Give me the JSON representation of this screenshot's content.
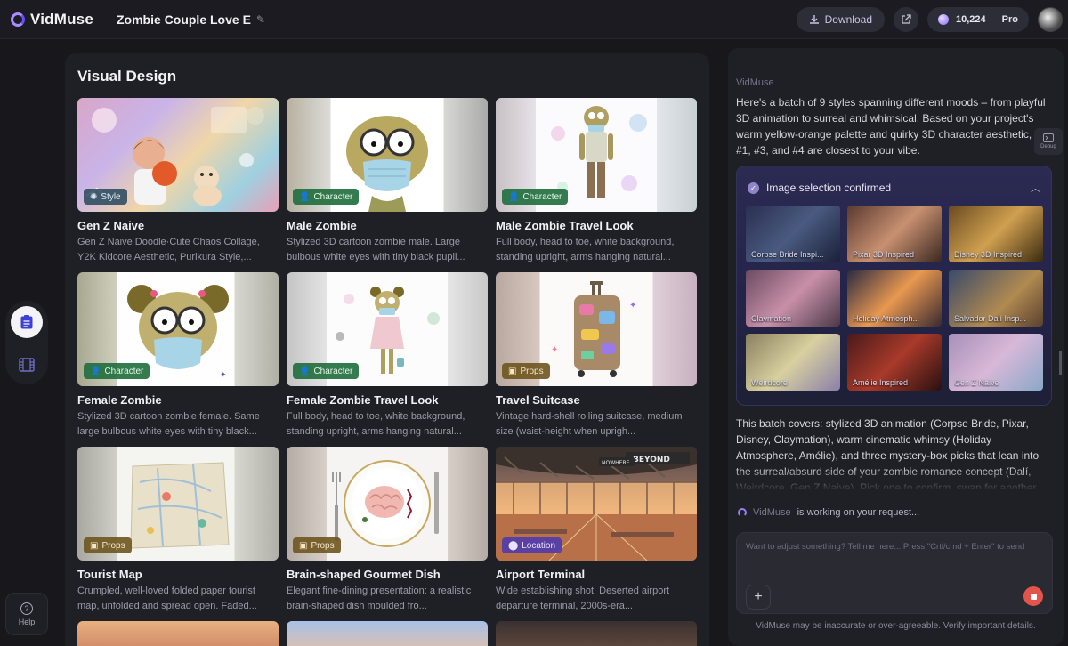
{
  "app": {
    "name": "VidMuse",
    "project_title": "Zombie Couple Love E"
  },
  "topbar": {
    "download_label": "Download",
    "credits": "10,224",
    "plan": "Pro"
  },
  "sidebar": {
    "help_label": "Help"
  },
  "main": {
    "title": "Visual Design",
    "cards": [
      {
        "title": "Gen Z Naive",
        "tag": "Style",
        "desc": "Gen Z Naive Doodle·Cute Chaos Collage, Y2K Kidcore Aesthetic, Purikura Style,..."
      },
      {
        "title": "Male Zombie",
        "tag": "Character",
        "desc": "Stylized 3D cartoon zombie male. Large bulbous white eyes with tiny black pupil..."
      },
      {
        "title": "Male Zombie Travel Look",
        "tag": "Character",
        "desc": "Full body, head to toe, white background, standing upright, arms hanging natural..."
      },
      {
        "title": "Female Zombie",
        "tag": "Character",
        "desc": "Stylized 3D cartoon zombie female. Same large bulbous white eyes with tiny black..."
      },
      {
        "title": "Female Zombie Travel Look",
        "tag": "Character",
        "desc": "Full body, head to toe, white background, standing upright, arms hanging natural..."
      },
      {
        "title": "Travel Suitcase",
        "tag": "Props",
        "desc": "Vintage hard-shell rolling suitcase, medium size (waist-height when uprigh..."
      },
      {
        "title": "Tourist Map",
        "tag": "Props",
        "desc": "Crumpled, well-loved folded paper tourist map, unfolded and spread open. Faded..."
      },
      {
        "title": "Brain-shaped Gourmet Dish",
        "tag": "Props",
        "desc": "Elegant fine-dining presentation: a realistic brain-shaped dish moulded fro..."
      },
      {
        "title": "Airport Terminal",
        "tag": "Location",
        "desc": "Wide establishing shot. Deserted airport departure terminal, 2000s-era..."
      }
    ],
    "signs": {
      "left": "NOWHERE",
      "right": "BEYOND"
    }
  },
  "panel": {
    "brand": "VidMuse",
    "message1": "Here's a batch of 9 styles spanning different moods – from playful 3D animation to surreal and whimsical. Based on your project's warm yellow-orange palette and quirky 3D character aesthetic, ons #1, #3, and #4 are closest to your vibe.",
    "debug_label": "Debug",
    "confirm_title": "Image selection confirmed",
    "images": [
      "Corpse Bride Inspi...",
      "Pixar 3D Inspired",
      "Disney 3D Inspired",
      "Claymation",
      "Holiday Atmosph...",
      "Salvador Dalí Insp...",
      "Weirdcore",
      "Amélie Inspired",
      "Gen Z Naive"
    ],
    "message2": "This batch covers: stylized 3D animation (Corpse Bride, Pixar, Disney, Claymation), warm cinematic whimsy (Holiday Atmosphere, Amélie), and three mystery-box picks that lean into the surreal/absurd side of your zombie romance concept (Dalí, Weirdcore, Gen Z Naive). Pick one to confirm, swap for another batch, or describe w",
    "working_brand": "VidMuse",
    "working_text": "is working on your request...",
    "input_placeholder": "Want to adjust something? Tell me here... Press \"Crtl/cmd + Enter\" to send",
    "disclaimer": "VidMuse may be inaccurate or over-agreeable. Verify important details."
  },
  "colors": {
    "accent": "#8b6cff",
    "stop": "#e5544a",
    "bg": "#17171c",
    "panel": "#1f1f26"
  }
}
